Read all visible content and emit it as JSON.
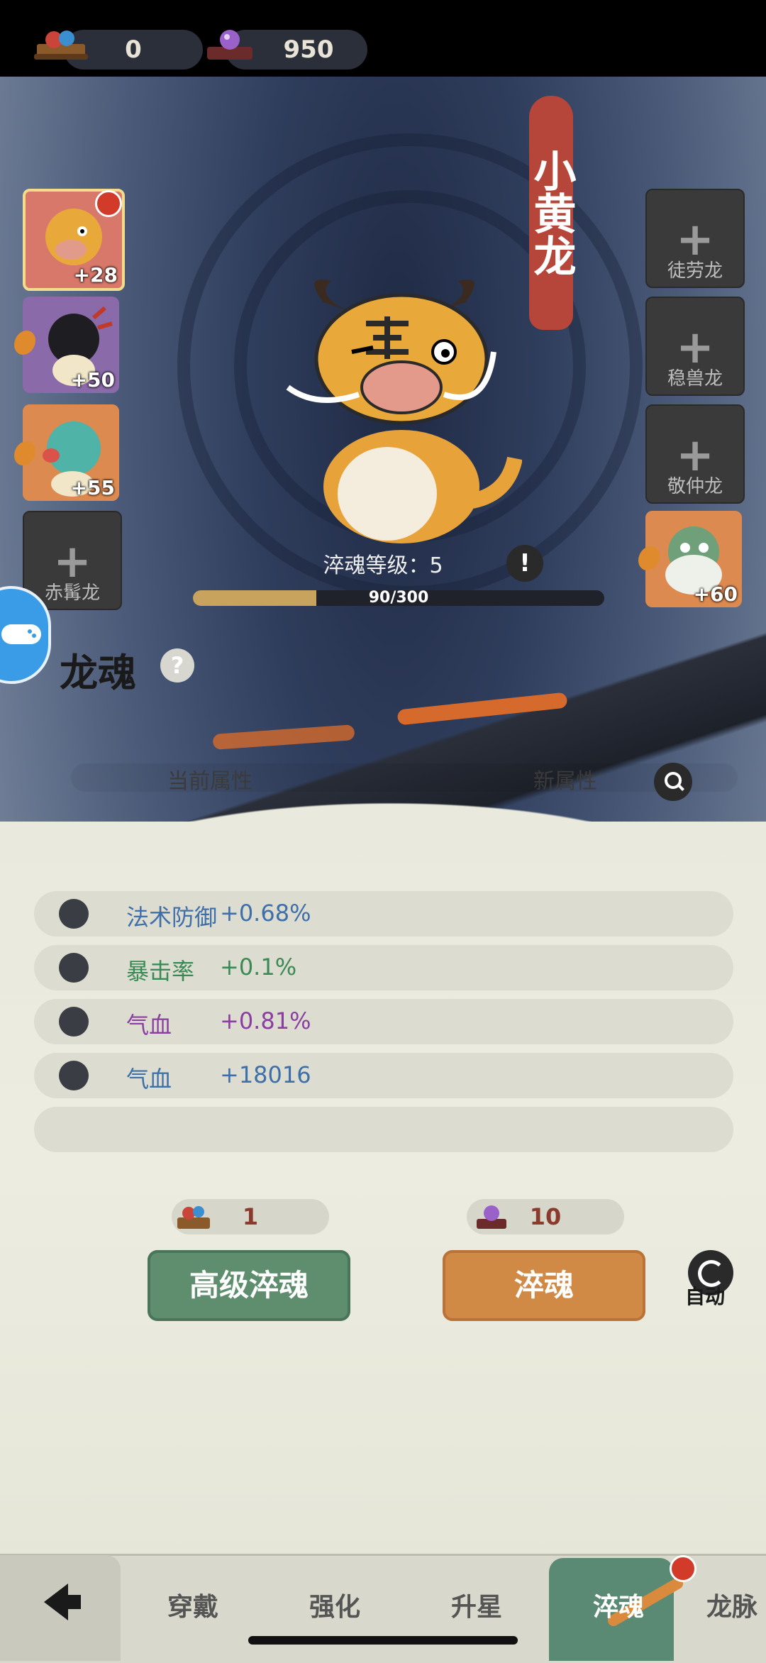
{
  "currencies": [
    {
      "icon": "chest-stone-icon",
      "value": "0"
    },
    {
      "icon": "purple-orb-icon",
      "value": "950"
    }
  ],
  "left_slots": [
    {
      "type": "dragon",
      "portrait": "yellow-tiger-dragon",
      "bonus": "+28",
      "selected": true,
      "notify": true
    },
    {
      "type": "dragon",
      "portrait": "black-dragon",
      "bonus": "+50"
    },
    {
      "type": "dragon",
      "portrait": "teal-dragon",
      "bonus": "+55"
    },
    {
      "type": "empty",
      "label": "赤髯龙"
    }
  ],
  "right_slots": [
    {
      "type": "empty",
      "label": "徒劳龙"
    },
    {
      "type": "empty",
      "label": "稳兽龙"
    },
    {
      "type": "empty",
      "label": "敬仲龙"
    },
    {
      "type": "dragon",
      "portrait": "white-beard-dragon",
      "bonus": "+60"
    }
  ],
  "dragon_name": "小黄龙",
  "level": {
    "label": "淬魂等级：5",
    "progress_text": "90/300",
    "current": 90,
    "max": 300
  },
  "section_title": "龙魂",
  "attributes": {
    "current_header": "当前属性",
    "new_header": "新属性",
    "rows": [
      {
        "name": "法术防御",
        "value": "+0.68%",
        "color": "#3e6fa8"
      },
      {
        "name": "暴击率",
        "value": "+0.1%",
        "color": "#3a8a55"
      },
      {
        "name": "气血",
        "value": "+0.81%",
        "color": "#8a3fa0"
      },
      {
        "name": "气血",
        "value": "+18016",
        "color": "#3e6fa8"
      }
    ]
  },
  "actions": {
    "advanced": {
      "label": "高级淬魂",
      "cost": "1"
    },
    "normal": {
      "label": "淬魂",
      "cost": "10"
    },
    "auto_label": "自动"
  },
  "nav": {
    "tabs": [
      "穿戴",
      "强化",
      "升星",
      "淬魂",
      "龙脉"
    ],
    "active": "淬魂"
  },
  "colors": {
    "accent_green": "#5e8e6e",
    "accent_orange": "#d18a45",
    "banner_red": "#b6463a"
  }
}
